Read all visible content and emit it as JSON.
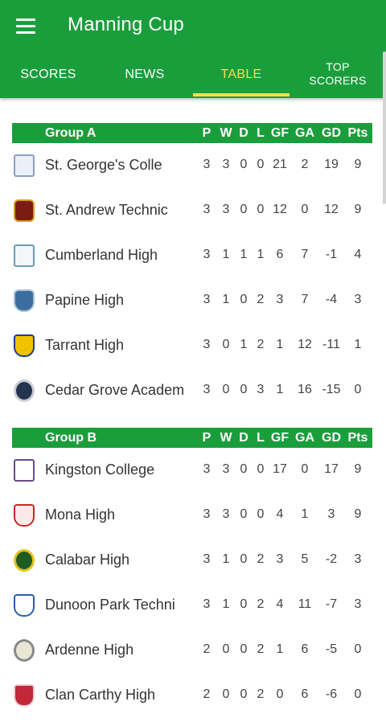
{
  "app": {
    "title": "Manning Cup",
    "menu_icon": "hamburger-menu-icon"
  },
  "tabs": [
    {
      "label": "SCORES",
      "active": false
    },
    {
      "label": "NEWS",
      "active": false
    },
    {
      "label": "TABLE",
      "active": true
    },
    {
      "label": "TOP\nSCORERS",
      "active": false
    }
  ],
  "columns": [
    "P",
    "W",
    "D",
    "L",
    "GF",
    "GA",
    "GD",
    "Pts"
  ],
  "colors": {
    "primary": "#1a9e3c",
    "accent": "#f2e14c",
    "text": "#333333"
  },
  "groups": [
    {
      "name": "Group A",
      "teams": [
        {
          "name": "St. George's Colle",
          "crest": "st-georges-crest-icon",
          "stats": [
            "3",
            "3",
            "0",
            "0",
            "21",
            "2",
            "19",
            "9"
          ]
        },
        {
          "name": "St. Andrew Technic",
          "crest": "st-andrew-crest-icon",
          "stats": [
            "3",
            "3",
            "0",
            "0",
            "12",
            "0",
            "12",
            "9"
          ]
        },
        {
          "name": "Cumberland High",
          "crest": "cumberland-crest-icon",
          "stats": [
            "3",
            "1",
            "1",
            "1",
            "6",
            "7",
            "-1",
            "4"
          ]
        },
        {
          "name": "Papine High",
          "crest": "papine-crest-icon",
          "stats": [
            "3",
            "1",
            "0",
            "2",
            "3",
            "7",
            "-4",
            "3"
          ]
        },
        {
          "name": "Tarrant High",
          "crest": "tarrant-crest-icon",
          "stats": [
            "3",
            "0",
            "1",
            "2",
            "1",
            "12",
            "-11",
            "1"
          ]
        },
        {
          "name": "Cedar Grove Academ",
          "crest": "cedar-grove-crest-icon",
          "stats": [
            "3",
            "0",
            "0",
            "3",
            "1",
            "16",
            "-15",
            "0"
          ]
        }
      ]
    },
    {
      "name": "Group B",
      "teams": [
        {
          "name": "Kingston College",
          "crest": "kingston-college-crest-icon",
          "stats": [
            "3",
            "3",
            "0",
            "0",
            "17",
            "0",
            "17",
            "9"
          ]
        },
        {
          "name": "Mona High",
          "crest": "mona-crest-icon",
          "stats": [
            "3",
            "3",
            "0",
            "0",
            "4",
            "1",
            "3",
            "9"
          ]
        },
        {
          "name": "Calabar High",
          "crest": "calabar-crest-icon",
          "stats": [
            "3",
            "1",
            "0",
            "2",
            "3",
            "5",
            "-2",
            "3"
          ]
        },
        {
          "name": "Dunoon Park Techni",
          "crest": "dunoon-park-crest-icon",
          "stats": [
            "3",
            "1",
            "0",
            "2",
            "4",
            "11",
            "-7",
            "3"
          ]
        },
        {
          "name": "Ardenne High",
          "crest": "ardenne-crest-icon",
          "stats": [
            "2",
            "0",
            "0",
            "2",
            "1",
            "6",
            "-5",
            "0"
          ]
        },
        {
          "name": "Clan Carthy High",
          "crest": "clan-carthy-crest-icon",
          "stats": [
            "2",
            "0",
            "0",
            "2",
            "0",
            "6",
            "-6",
            "0"
          ]
        }
      ]
    }
  ]
}
